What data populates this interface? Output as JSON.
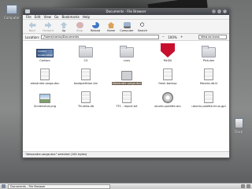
{
  "window": {
    "title": "Documents - File Browser"
  },
  "menu": [
    "File",
    "Edit",
    "View",
    "Go",
    "Bookmarks",
    "Help"
  ],
  "toolbar": {
    "back": "Back",
    "forward": "Forward",
    "up": "Up",
    "stop": "Stop",
    "reload": "Reload",
    "home": "Home",
    "computer": "Computer",
    "search": "Search"
  },
  "location": {
    "label": "Location:",
    "value": "/home/carlos/Documents",
    "zoom_out": "−",
    "zoom_level": "100%",
    "zoom_in": "+",
    "view_mode": "View as Icons"
  },
  "files": [
    {
      "name": "Carlson",
      "icon": "carlson-logo-icon",
      "logo_text": [
        "Carlson",
        "Construction"
      ]
    },
    {
      "name": "CV",
      "icon": "folder-icon"
    },
    {
      "name": "cvns",
      "icon": "folder-icon"
    },
    {
      "name": "McGill",
      "icon": "mcgill-logo-icon"
    },
    {
      "name": "Pictures",
      "icon": "folder-icon"
    },
    {
      "name": "alexandre.xorga.doc",
      "icon": "document-icon"
    },
    {
      "name": "bootpartition.bin",
      "icon": "document-icon"
    },
    {
      "name": "Alexandre.xorga.doc",
      "icon": "package-icon",
      "selected": true
    },
    {
      "name": "fresh.backup",
      "icon": "document-icon"
    },
    {
      "name": "Movies.db.tt",
      "icon": "document-icon"
    },
    {
      "name": "Screenshot.png",
      "icon": "image-icon"
    },
    {
      "name": "Thumbs.db",
      "icon": "document-icon"
    },
    {
      "name": "TF1 - report.txt",
      "icon": "document-icon"
    },
    {
      "name": "ubuntu.palette.acc",
      "icon": "executable-icon"
    },
    {
      "name": "ubuntu.palette.linux.gpl",
      "icon": "document-icon"
    }
  ],
  "status": "\"Alexandre.xorga.doc\" selected (161 bytes)",
  "desktop": {
    "top_left_icon": "Computer",
    "trash": "Trash"
  },
  "taskbar": {
    "task": "Documents - File Browser"
  }
}
